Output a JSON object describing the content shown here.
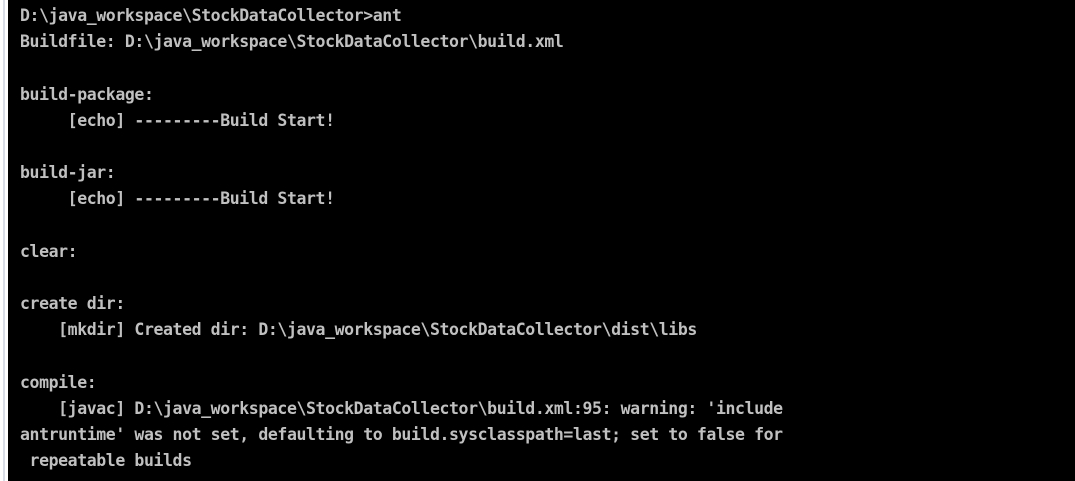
{
  "console": {
    "text_color": "#c0c0c0",
    "background_color": "#000000",
    "lines": [
      "D:\\java_workspace\\StockDataCollector>ant",
      "Buildfile: D:\\java_workspace\\StockDataCollector\\build.xml",
      "",
      "build-package:",
      "     [echo] ---------Build Start!",
      "",
      "build-jar:",
      "     [echo] ---------Build Start!",
      "",
      "clear:",
      "",
      "create dir:",
      "    [mkdir] Created dir: D:\\java_workspace\\StockDataCollector\\dist\\libs",
      "",
      "compile:",
      "    [javac] D:\\java_workspace\\StockDataCollector\\build.xml:95: warning: 'include",
      "antruntime' was not set, defaulting to build.sysclasspath=last; set to false for",
      " repeatable builds"
    ]
  }
}
